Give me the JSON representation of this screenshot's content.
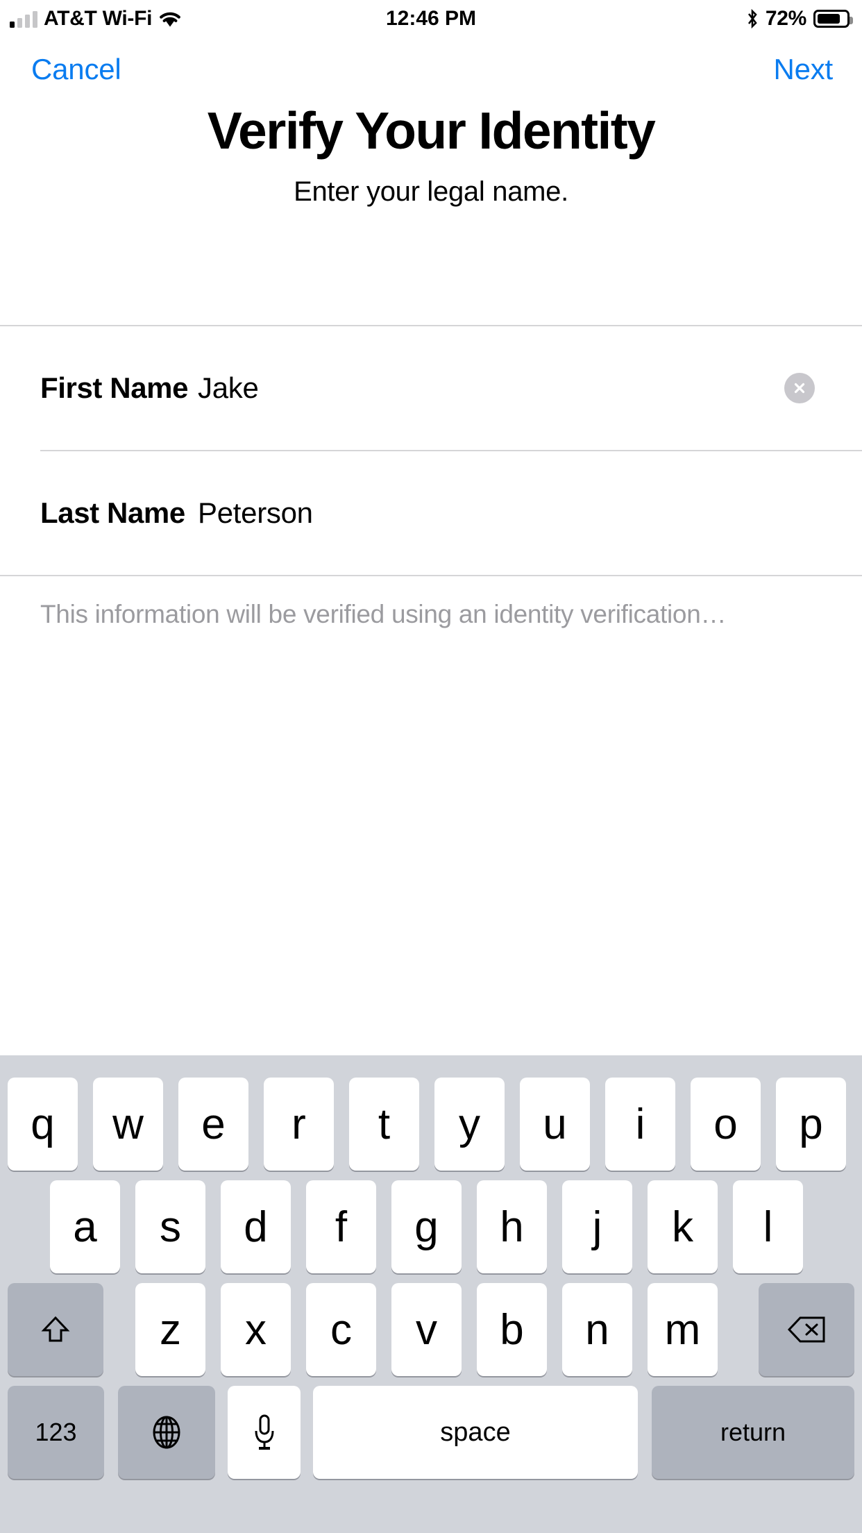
{
  "status_bar": {
    "carrier": "AT&T Wi-Fi",
    "time": "12:46 PM",
    "battery_percent": "72%",
    "signal_bars_filled": 1,
    "signal_bars_total": 4,
    "icons": [
      "signal-bars-icon",
      "wifi-icon",
      "bluetooth-icon",
      "battery-icon"
    ]
  },
  "nav": {
    "cancel_label": "Cancel",
    "next_label": "Next",
    "accent_color": "#0a7cf0"
  },
  "header": {
    "title": "Verify Your Identity",
    "subtitle": "Enter your legal name."
  },
  "form": {
    "first_name": {
      "label": "First Name",
      "value": "Jake",
      "placeholder": "First Name",
      "has_clear_button": true
    },
    "last_name": {
      "label": "Last Name",
      "value": "Peterson",
      "placeholder": "Last Name",
      "has_clear_button": false
    },
    "footer_note": "This information will be verified using an identity verification…",
    "footer_note_color": "#9b9b9f"
  },
  "keyboard": {
    "row1": [
      "q",
      "w",
      "e",
      "r",
      "t",
      "y",
      "u",
      "i",
      "o",
      "p"
    ],
    "row2": [
      "a",
      "s",
      "d",
      "f",
      "g",
      "h",
      "j",
      "k",
      "l"
    ],
    "row3_letters": [
      "z",
      "x",
      "c",
      "v",
      "b",
      "n",
      "m"
    ],
    "shift_label": "shift-key",
    "backspace_label": "delete-key",
    "numbers_label": "123",
    "globe_label": "globe-key",
    "dictation_label": "microphone-key",
    "space_label": "space",
    "return_label": "return",
    "background_color": "#d1d4da",
    "key_color": "#ffffff",
    "modifier_key_color": "#aeb3bd"
  }
}
